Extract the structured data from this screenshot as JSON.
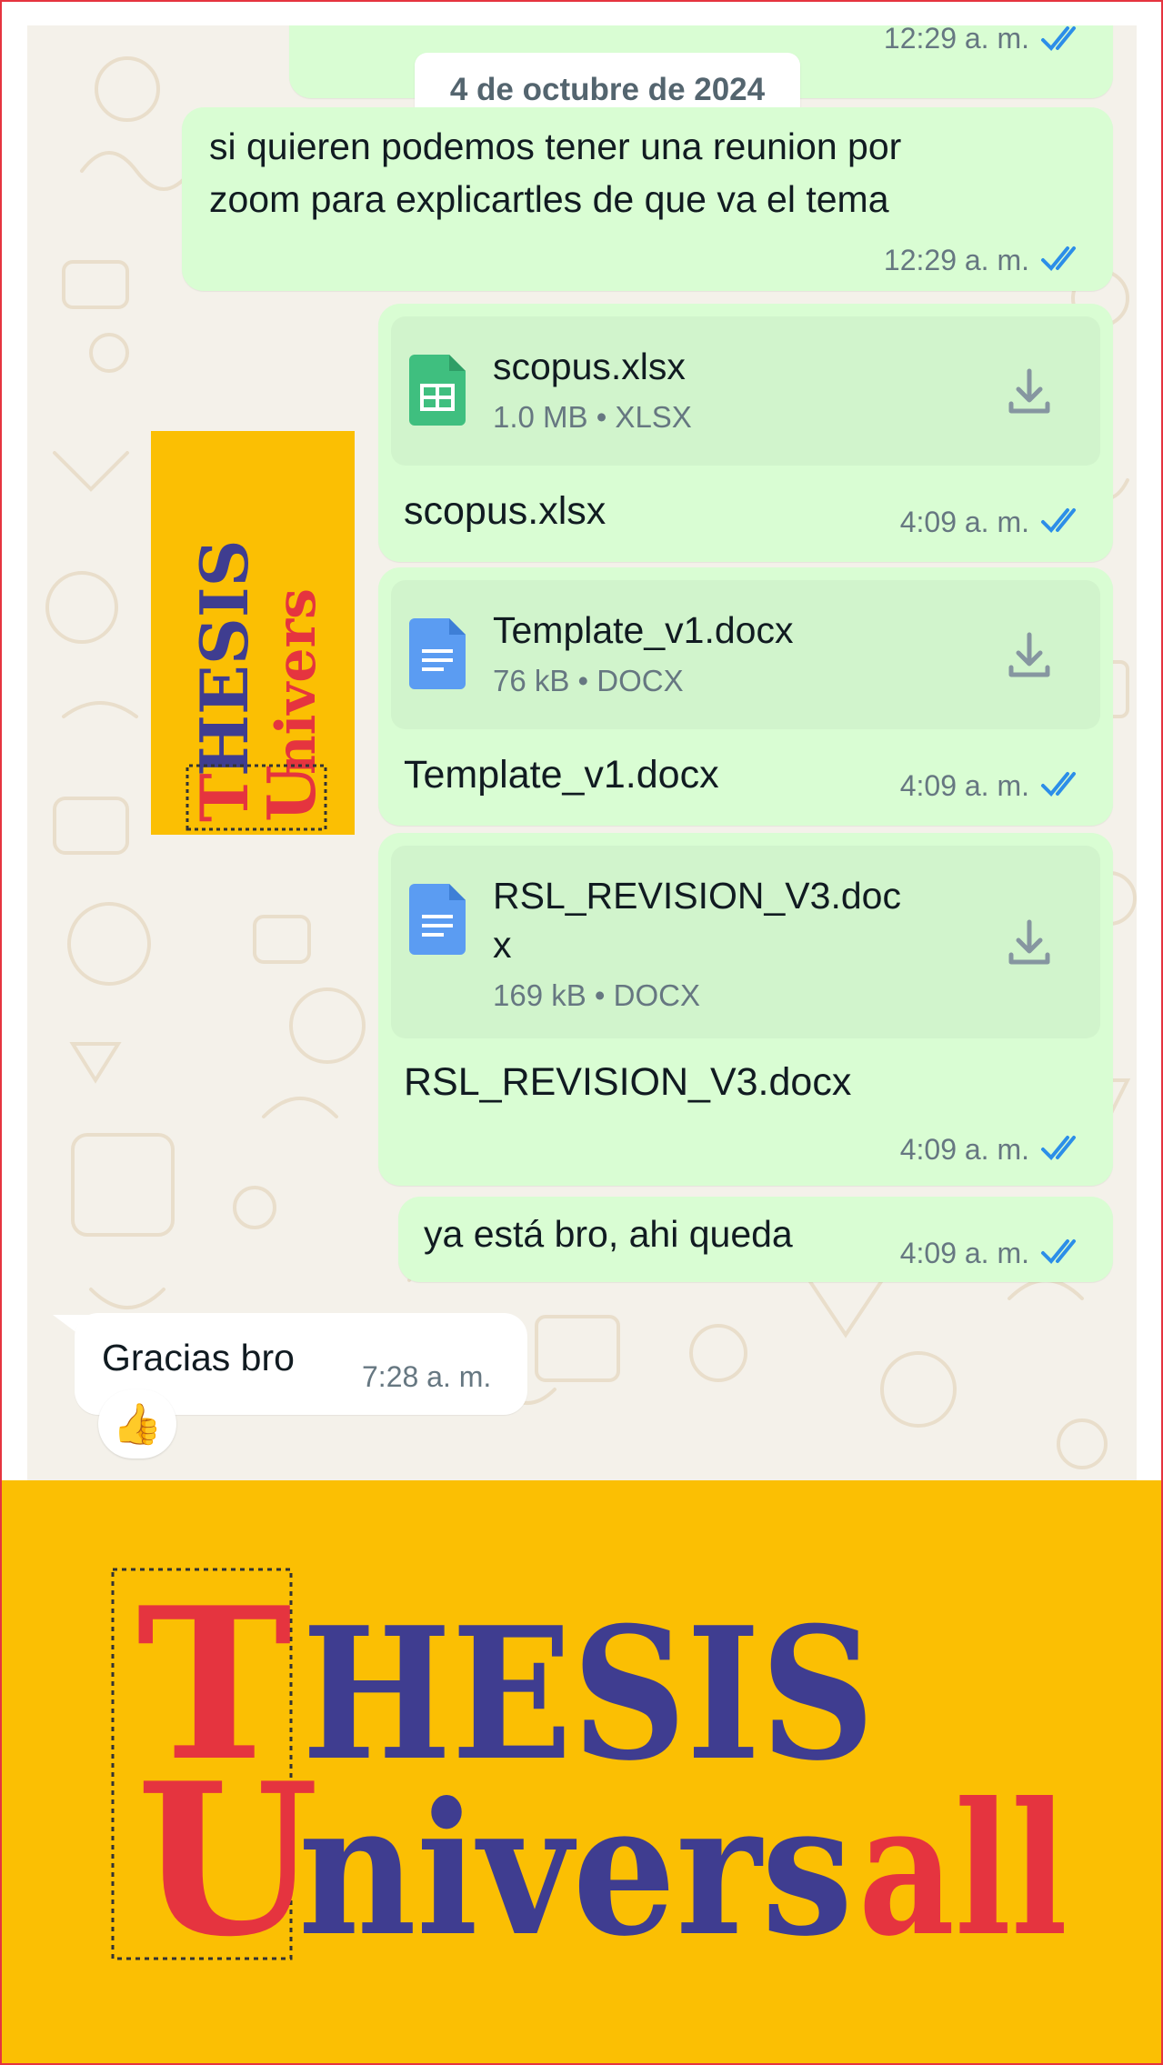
{
  "chat": {
    "date_chip": "4 de octubre de 2024",
    "top_time": "12:29 a. m.",
    "messages": [
      {
        "text_line1": "si quieren podemos tener una reunion por",
        "text_line2": "zoom para explicartles de que va el tema",
        "time": "12:29 a. m."
      }
    ],
    "files": [
      {
        "name": "scopus.xlsx",
        "meta": "1.0 MB • XLSX",
        "caption": "scopus.xlsx",
        "time": "4:09 a. m.",
        "icon": "spreadsheet-icon",
        "icon_color": "#3fbf7f"
      },
      {
        "name": "Template_v1.docx",
        "meta": "76 kB • DOCX",
        "caption": "Template_v1.docx",
        "time": "4:09 a. m.",
        "icon": "document-icon",
        "icon_color": "#5b9cf2"
      },
      {
        "name_line1": "RSL_REVISION_V3.doc",
        "name_line2": "x",
        "meta": "169 kB • DOCX",
        "caption": "RSL_REVISION_V3.docx",
        "time": "4:09 a. m.",
        "icon": "document-icon",
        "icon_color": "#5b9cf2"
      }
    ],
    "short_msg": {
      "text": "ya está bro, ahi queda",
      "time": "4:09 a. m."
    },
    "incoming": {
      "text": "Gracias bro",
      "time": "7:28 a. m.",
      "reaction": "👍"
    }
  },
  "brand": {
    "line1_first": "T",
    "line1_rest": "HESIS",
    "line2_first": "U",
    "line2_mid": "nivers",
    "line2_end": "all"
  },
  "colors": {
    "outgoing_bubble": "#d9fdd3",
    "read_ticks": "#2c8ee8",
    "brand_yellow": "#fbbf03",
    "brand_red": "#e5343f",
    "brand_navy": "#3f3d90"
  }
}
